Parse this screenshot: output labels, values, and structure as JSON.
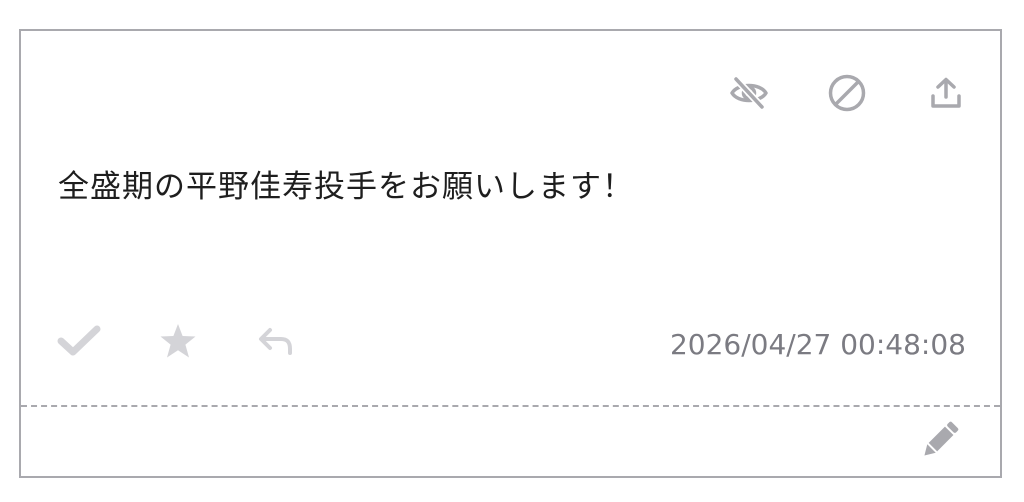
{
  "post": {
    "message": "全盛期の平野佳寿投手をお願いします！",
    "timestamp": "2026/04/27 00:48:08"
  },
  "top_actions": [
    {
      "icon": "eye-slash-icon"
    },
    {
      "icon": "ban-icon"
    },
    {
      "icon": "upload-icon"
    }
  ],
  "bottom_actions": [
    {
      "icon": "check-icon"
    },
    {
      "icon": "star-icon"
    },
    {
      "icon": "reply-icon"
    }
  ],
  "footer": {
    "icon": "pencil-icon"
  },
  "colors": {
    "icon_dark": "#a9a9ae",
    "icon_light": "#d4d4d8",
    "text": "#1e1e1e",
    "timestamp": "#7b7b82",
    "border": "#a9a9ae"
  }
}
